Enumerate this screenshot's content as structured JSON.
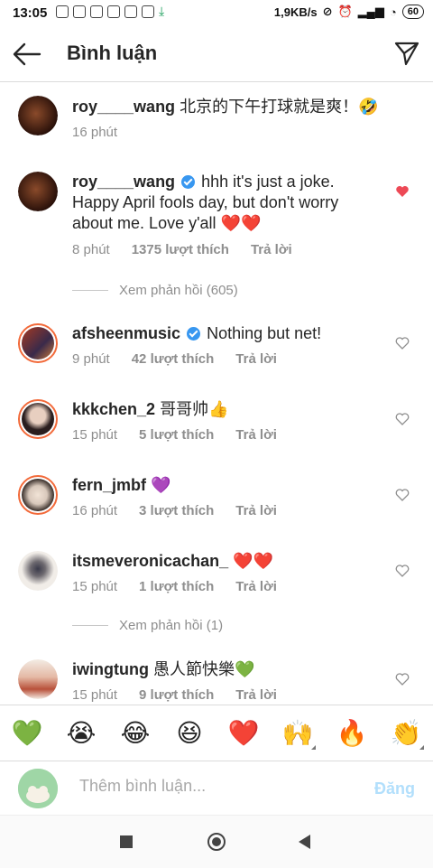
{
  "status": {
    "time": "13:05",
    "net_speed": "1,9KB/s",
    "battery": "60"
  },
  "header": {
    "title": "Bình luận"
  },
  "comments": [
    {
      "user": "roy____wang",
      "verified": false,
      "text": "北京的下午打球就是爽！🤣",
      "time": "16 phút",
      "likes": "",
      "reply": "",
      "liked": false,
      "avatar_color": "#3a1d12"
    },
    {
      "user": "roy____wang",
      "verified": true,
      "text": "hhh it's just a joke. Happy April fools day, but don't worry about me. Love y'all ❤️❤️",
      "time": "8 phút",
      "likes": "1375 lượt thích",
      "reply": "Trả lời",
      "liked": true,
      "avatar_color": "#3a1d12"
    },
    {
      "user": "afsheenmusic",
      "verified": true,
      "text": "Nothing but net!",
      "time": "9 phút",
      "likes": "42 lượt thích",
      "reply": "Trả lời",
      "liked": false,
      "avatar_color": "#7a2e1e"
    },
    {
      "user": "kkkchen_2",
      "verified": false,
      "text": "哥哥帅👍",
      "time": "15 phút",
      "likes": "5 lượt thích",
      "reply": "Trả lời",
      "liked": false,
      "avatar_color": "#3b2a2a"
    },
    {
      "user": "fern_jmbf",
      "verified": false,
      "text": "💜",
      "time": "16 phút",
      "likes": "3 lượt thích",
      "reply": "Trả lời",
      "liked": false,
      "avatar_color": "#b9b0a8"
    },
    {
      "user": "itsmeveronicachan_",
      "verified": false,
      "text": "❤️❤️",
      "time": "15 phút",
      "likes": "1 lượt thích",
      "reply": "Trả lời",
      "liked": false,
      "avatar_color": "#e8e3dc"
    },
    {
      "user": "iwingtung",
      "verified": false,
      "text": "愚人節快樂💚",
      "time": "15 phút",
      "likes": "9 lượt thích",
      "reply": "Trả lời",
      "liked": false,
      "avatar_color": "#c98a6e"
    }
  ],
  "view_replies": [
    "Xem phản hồi (605)",
    "Xem phản hồi (1)"
  ],
  "emoji_bar": [
    "💚",
    "😭",
    "😂",
    "😆",
    "❤️",
    "🙌",
    "🔥",
    "👏"
  ],
  "input": {
    "placeholder": "Thêm bình luận...",
    "post_label": "Đăng"
  },
  "colors": {
    "accent": "#3897f0",
    "like_red": "#ed4956",
    "muted": "#8e8e8e"
  }
}
